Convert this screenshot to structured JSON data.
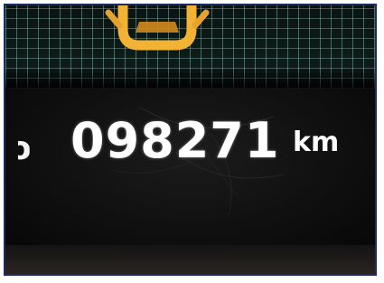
{
  "odometer": {
    "prefix": "o",
    "reading": "098271",
    "unit": "km"
  },
  "icons": {
    "warning_car": "car-door-open-icon"
  },
  "colors": {
    "frame_border": "#1c2a6b",
    "warning_icon": "#f2b233",
    "digits": "#ffffff",
    "grid": "#aadccd"
  }
}
